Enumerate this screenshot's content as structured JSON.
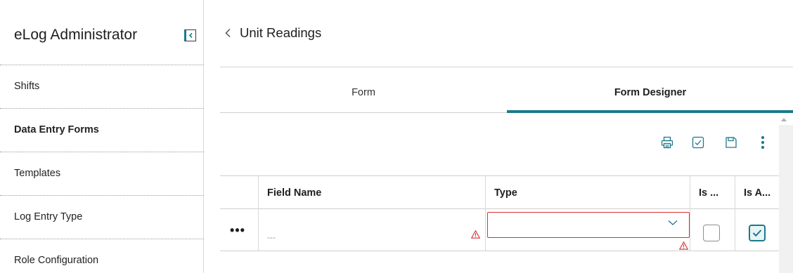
{
  "sidebar": {
    "title": "eLog Administrator",
    "collapse_icon": "collapse-sidebar-icon",
    "items": [
      {
        "label": "Shifts",
        "active": false
      },
      {
        "label": "Data Entry Forms",
        "active": true
      },
      {
        "label": "Templates",
        "active": false
      },
      {
        "label": "Log Entry Type",
        "active": false
      },
      {
        "label": "Role Configuration",
        "active": false
      }
    ]
  },
  "header": {
    "back_icon": "chevron-left-icon",
    "title": "Unit Readings"
  },
  "tabs": [
    {
      "label": "Form",
      "active": false
    },
    {
      "label": "Form Designer",
      "active": true
    }
  ],
  "toolbar": {
    "icons": [
      "print-icon",
      "validate-icon",
      "save-icon",
      "more-vertical-icon"
    ]
  },
  "grid": {
    "columns": [
      "",
      "Field Name",
      "Type",
      "Is ...",
      "Is A..."
    ],
    "rows": [
      {
        "menu": "•••",
        "field_name_placeholder": "---",
        "field_name_error": true,
        "type_value": "",
        "type_error": true,
        "col4_checked": false,
        "col5_checked": true
      }
    ]
  },
  "colors": {
    "accent": "#1b7a8c",
    "error": "#d93030",
    "border": "#cfcfcf"
  }
}
